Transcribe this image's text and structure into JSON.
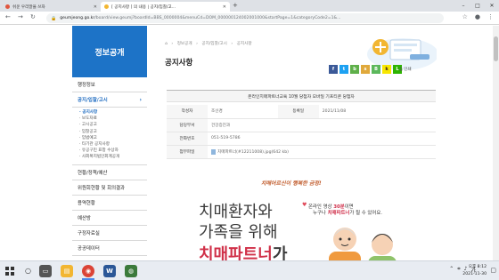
{
  "browser": {
    "tabs": [
      {
        "label": "쉬운 우리말을 쓰자",
        "active": false
      },
      {
        "label": "[ 공지사항 ] 의 내용 | 공지/입찰/고...",
        "active": true
      }
    ],
    "new_tab": "+",
    "window_controls": [
      "–",
      "□",
      "✕"
    ],
    "url_domain": "geumjeong.go.kr",
    "url_path": "/board/view.geumj?boardId=BBS_0000004&menuCd=DOM_000000124002001000&startPage=1&categoryCode2=1&..."
  },
  "sidebar": {
    "header": "정보공개",
    "items": [
      {
        "label": "행정정보",
        "active": false
      },
      {
        "label": "공지/입찰/고시",
        "active": true
      }
    ],
    "subitems": [
      {
        "label": "· 공지사항",
        "selected": true
      },
      {
        "label": "· 보도자료",
        "selected": false
      },
      {
        "label": "· 고시공고",
        "selected": false
      },
      {
        "label": "· 입찰공고",
        "selected": false
      },
      {
        "label": "· 입법예고",
        "selected": false
      },
      {
        "label": "· 타기관 공지사항",
        "selected": false
      },
      {
        "label": "· 유공구민 표창 수상자",
        "selected": false
      },
      {
        "label": "· 사회복지법인회계공개",
        "selected": false
      }
    ],
    "items_after": [
      {
        "label": "현황/정책/예산"
      },
      {
        "label": "위원회현황 및 회의결과"
      },
      {
        "label": "용역현황"
      },
      {
        "label": "예산방"
      },
      {
        "label": "구정자료실"
      },
      {
        "label": "공공데이터"
      }
    ]
  },
  "main": {
    "breadcrumb": [
      "정보공개",
      "공지/입찰/고시",
      "공지사항"
    ],
    "page_title": "공지사항",
    "print_label": "인쇄",
    "post_title": "온라인치매파트너교육 10월 당첨자 모바일 기프티콘 당첨자",
    "fields": {
      "author_label": "작성자",
      "author": "조선경",
      "date_label": "등록일",
      "date": "2021/11/08",
      "dept_label": "담당부서",
      "dept": "건강증진과",
      "phone_label": "전화번호",
      "phone": "051-519-5786",
      "attach_label": "첨부파일",
      "attach": "치매파트너(#12211008).jpg(642 kb)"
    }
  },
  "poster": {
    "slogan": "치매어르신이 행복한 금정!",
    "line1": "치매환자와",
    "line2": "가족을 위해",
    "line3": "치매파트너",
    "line3_suffix": "가",
    "side1_prefix": "온라인 영상 ",
    "side1_highlight": "30분",
    "side1_suffix": "이면",
    "side2_prefix": "누구나 ",
    "side2_highlight": "치매파트너",
    "side2_suffix": "가 될 수 있어요."
  },
  "taskbar": {
    "time": "오후 8:12",
    "date": "2021-11-30"
  },
  "colors": {
    "sidebar_header": "#1d73c7",
    "accent_red": "#d03048",
    "active_link": "#1d6bc0"
  }
}
